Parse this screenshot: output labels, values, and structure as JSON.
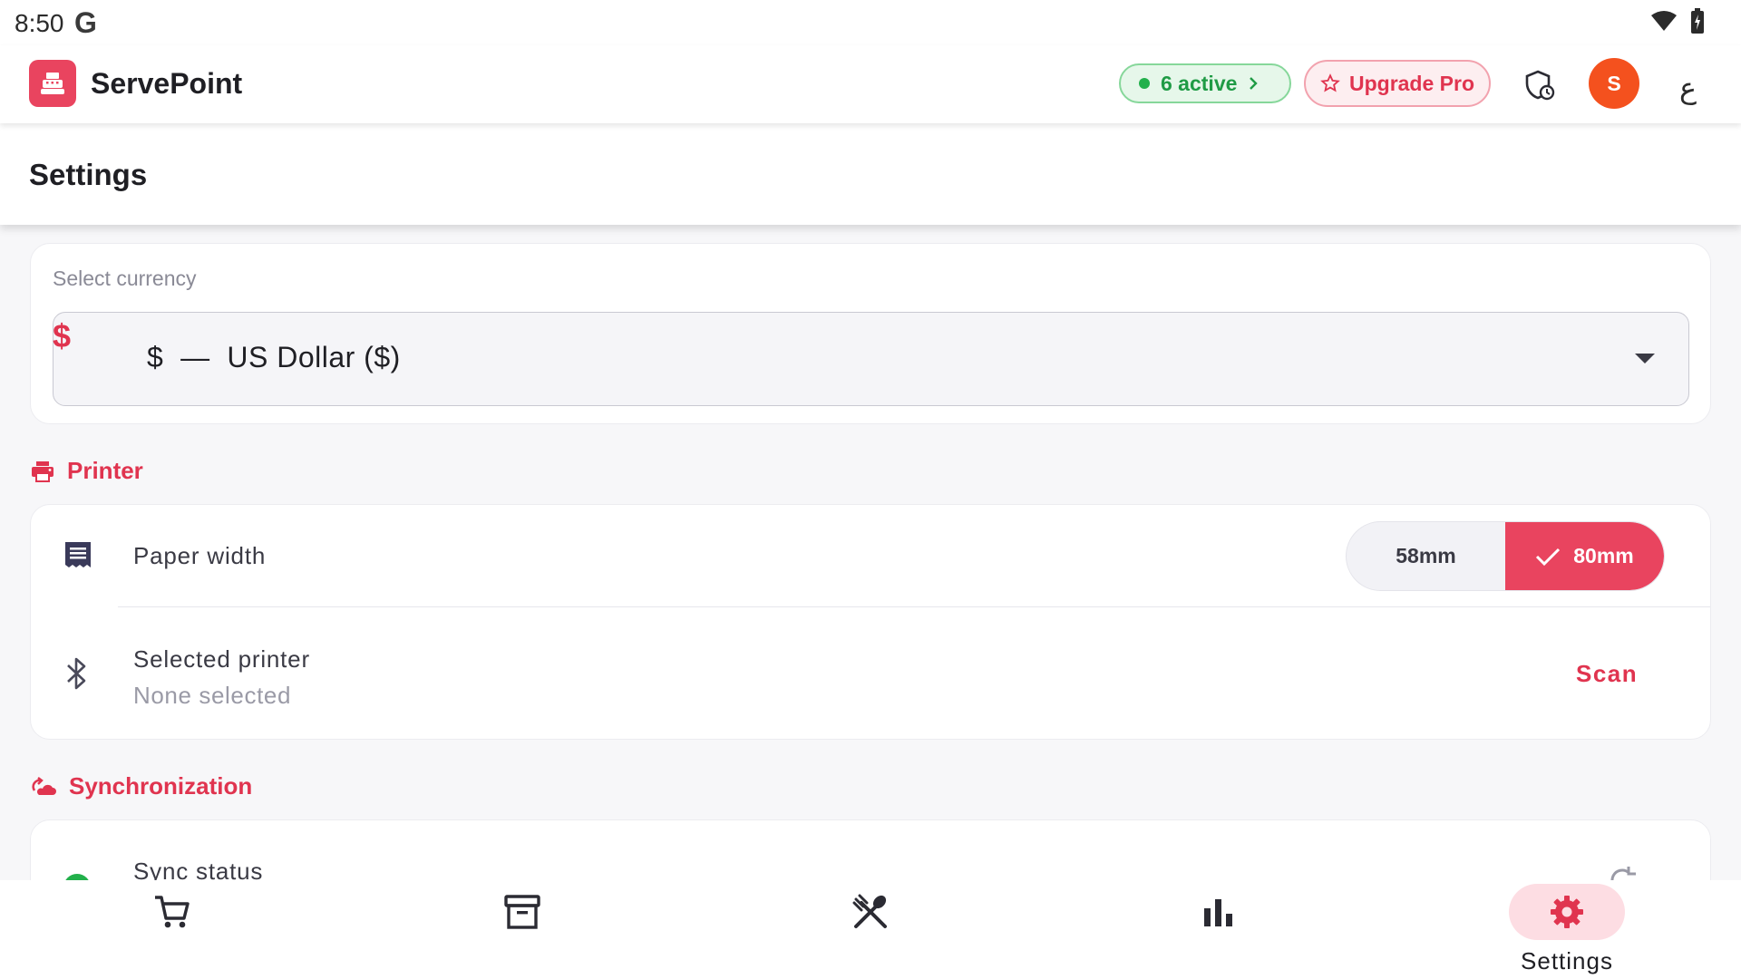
{
  "status_bar": {
    "time": "8:50",
    "g_logo": "G",
    "icons": [
      "wifi-icon",
      "battery-icon"
    ]
  },
  "app_bar": {
    "app_name": "ServePoint",
    "active_label": "6 active",
    "upgrade_label": "Upgrade Pro",
    "avatar_initial": "S",
    "more_glyph": "ع"
  },
  "page": {
    "title": "Settings"
  },
  "currency": {
    "label": "Select currency",
    "icon_glyph": "$",
    "value": "$  —  US Dollar ($)"
  },
  "printer": {
    "section_title": "Printer",
    "paper_width_label": "Paper width",
    "options": [
      "58mm",
      "80mm"
    ],
    "selected_option": "80mm",
    "selected_printer_label": "Selected printer",
    "selected_printer_value": "None selected",
    "scan_label": "Scan"
  },
  "sync": {
    "section_title": "Synchronization",
    "status_label": "Sync status"
  },
  "bottom_nav": {
    "items": [
      {
        "icon": "cart-icon"
      },
      {
        "icon": "archive-icon"
      },
      {
        "icon": "restaurant-icon"
      },
      {
        "icon": "bar-chart-icon"
      },
      {
        "icon": "gear-icon",
        "label": "Settings",
        "active": true
      }
    ]
  },
  "colors": {
    "accent": "#e9445f",
    "success": "#22b04b",
    "avatar": "#f4511e"
  }
}
